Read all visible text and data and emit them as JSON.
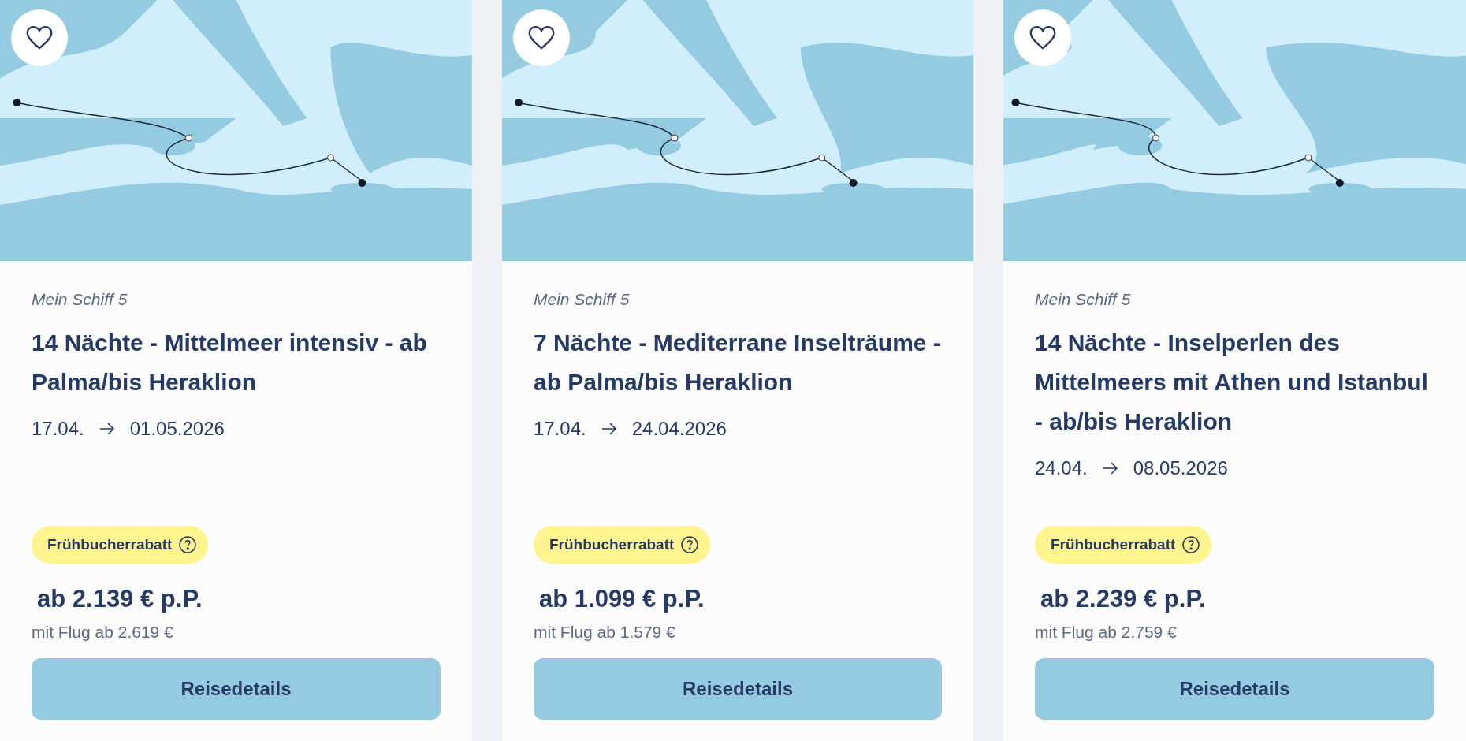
{
  "cards": [
    {
      "ship": "Mein Schiff 5",
      "title": "14 Nächte - Mittelmeer intensiv - ab Palma/bis Heraklion",
      "date_from": "17.04.",
      "date_to": "01.05.2026",
      "badge": "Frühbucherrabatt",
      "price": "ab 2.139 € p.P.",
      "flight_price": "mit Flug ab 2.619 €",
      "button": "Reisedetails"
    },
    {
      "ship": "Mein Schiff 5",
      "title": "7 Nächte - Mediterrane Inselträume - ab Palma/bis Heraklion",
      "date_from": "17.04.",
      "date_to": "24.04.2026",
      "badge": "Frühbucherrabatt",
      "price": "ab 1.099 € p.P.",
      "flight_price": "mit Flug ab 1.579 €",
      "button": "Reisedetails"
    },
    {
      "ship": "Mein Schiff 5",
      "title": "14 Nächte - Inselperlen des Mittelmeers mit Athen und Istanbul - ab/bis Heraklion",
      "date_from": "24.04.",
      "date_to": "08.05.2026",
      "badge": "Frühbucherrabatt",
      "price": "ab 2.239 € p.P.",
      "flight_price": "mit Flug ab 2.759 €",
      "button": "Reisedetails"
    }
  ]
}
